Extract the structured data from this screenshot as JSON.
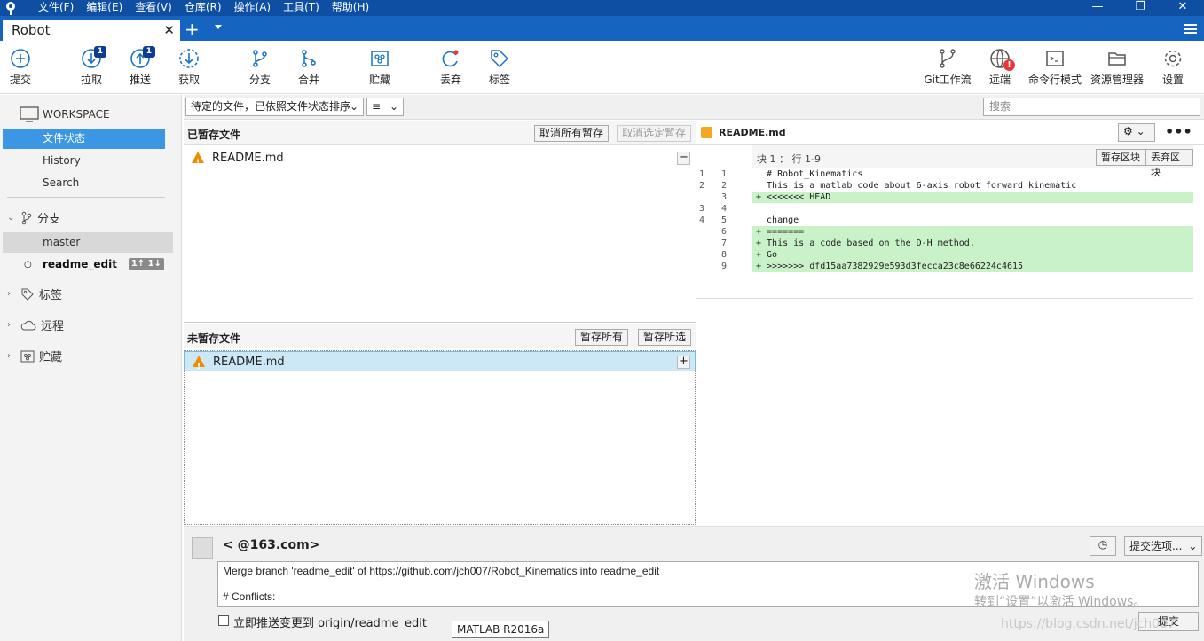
{
  "menu": [
    "文件(F)",
    "编辑(E)",
    "查看(V)",
    "仓库(R)",
    "操作(A)",
    "工具(T)",
    "帮助(H)"
  ],
  "tab": {
    "title": "Robot"
  },
  "toolbar": {
    "commit": "提交",
    "pull": "拉取",
    "pull_badge": "1",
    "push": "推送",
    "push_badge": "1",
    "fetch": "获取",
    "branch": "分支",
    "merge": "合并",
    "stash": "贮藏",
    "discard": "丢弃",
    "tag": "标签",
    "gitflow": "Git工作流",
    "remote": "远端",
    "terminal": "命令行模式",
    "explorer": "资源管理器",
    "settings": "设置"
  },
  "sidebar": {
    "workspace": "WORKSPACE",
    "file_status": "文件状态",
    "history": "History",
    "search": "Search",
    "branches": "分支",
    "master": "master",
    "readme_edit": "readme_edit",
    "readme_badge": "1↑ 1↓",
    "tags": "标签",
    "remotes": "远程",
    "stashes": "贮藏"
  },
  "filter": {
    "sort": "待定的文件，已依照文件状态排序",
    "view": "≡",
    "search_placeholder": "搜索"
  },
  "staged": {
    "title": "已暂存文件",
    "unstage_all": "取消所有暂存",
    "unstage_selected": "取消选定暂存",
    "file": "README.md"
  },
  "unstaged": {
    "title": "未暂存文件",
    "stage_all": "暂存所有",
    "stage_selected": "暂存所选",
    "file": "README.md"
  },
  "diff": {
    "file": "README.md",
    "hunk": "块 1 ： 行 1-9",
    "stage_hunk": "暂存区块",
    "discard_hunk": "丢弃区块",
    "lines": [
      {
        "o": "1",
        "n": "1",
        "t": "  # Robot_Kinematics",
        "add": false
      },
      {
        "o": "2",
        "n": "2",
        "t": "  This is a matlab code about 6-axis robot forward kinematic",
        "add": false
      },
      {
        "o": "",
        "n": "3",
        "t": "+ <<<<<<< HEAD",
        "add": true
      },
      {
        "o": "3",
        "n": "4",
        "t": "  ",
        "add": false
      },
      {
        "o": "4",
        "n": "5",
        "t": "  change",
        "add": false
      },
      {
        "o": "",
        "n": "6",
        "t": "+ =======",
        "add": true
      },
      {
        "o": "",
        "n": "7",
        "t": "+ This is a code based on the D-H method.",
        "add": true
      },
      {
        "o": "",
        "n": "8",
        "t": "+ Go",
        "add": true
      },
      {
        "o": "",
        "n": "9",
        "t": "+ >>>>>>> dfd15aa7382929e593d3fecca23c8e66224c4615",
        "add": true
      }
    ]
  },
  "commit": {
    "author": "< @163.com>",
    "options": "提交选项...",
    "message_line1": "Merge branch 'readme_edit' of https://github.com/jch007/Robot_Kinematics into readme_edit",
    "message_line2": "# Conflicts:",
    "push_checkbox": "立即推送变更到 origin/readme_edit",
    "tooltip": "MATLAB R2016a",
    "submit": "提交"
  },
  "watermark": {
    "line1": "激活 Windows",
    "line2": "转到“设置”以激活 Windows。",
    "url": "https://blog.csdn.net/jch007"
  }
}
